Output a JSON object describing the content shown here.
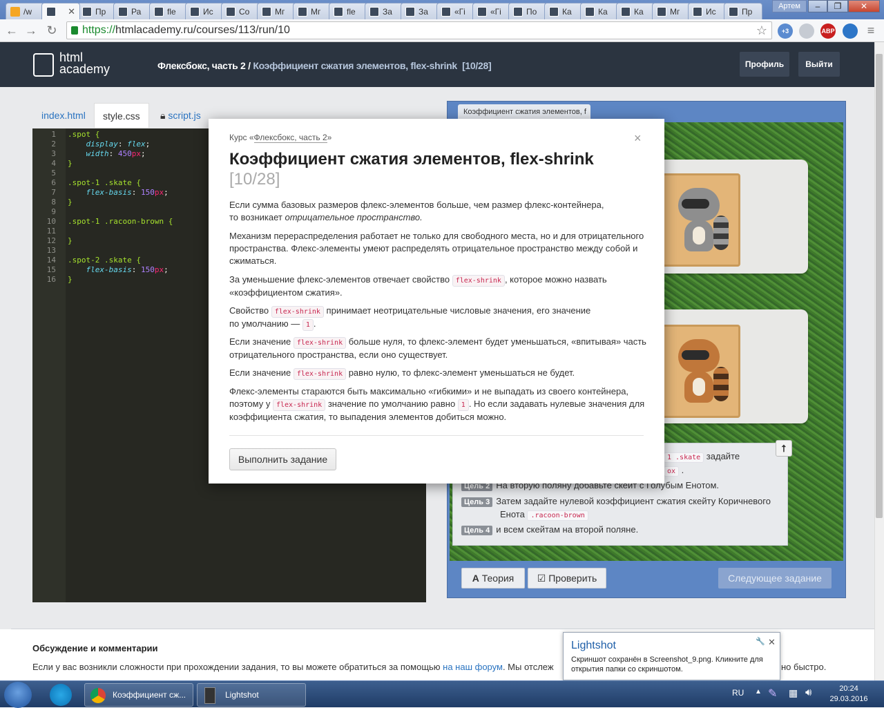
{
  "browser": {
    "tabs": [
      {
        "label": "/w",
        "favicon": "bolt"
      },
      {
        "label": "",
        "favicon": "htmlacademy",
        "active": true
      },
      {
        "label": "Пр",
        "favicon": "htmlacademy"
      },
      {
        "label": "Ра",
        "favicon": "htmlacademy"
      },
      {
        "label": "fle",
        "favicon": "htmlacademy"
      },
      {
        "label": "Ис",
        "favicon": "htmlacademy"
      },
      {
        "label": "Со",
        "favicon": "htmlacademy"
      },
      {
        "label": "Мг",
        "favicon": "htmlacademy"
      },
      {
        "label": "Мг",
        "favicon": "htmlacademy"
      },
      {
        "label": "fle",
        "favicon": "htmlacademy"
      },
      {
        "label": "За",
        "favicon": "htmlacademy"
      },
      {
        "label": "За",
        "favicon": "htmlacademy"
      },
      {
        "label": "«Гі",
        "favicon": "htmlacademy"
      },
      {
        "label": "«Гі",
        "favicon": "htmlacademy"
      },
      {
        "label": "По",
        "favicon": "htmlacademy"
      },
      {
        "label": "Ка",
        "favicon": "htmlacademy"
      },
      {
        "label": "Ка",
        "favicon": "htmlacademy"
      },
      {
        "label": "Ка",
        "favicon": "htmlacademy"
      },
      {
        "label": "Мг",
        "favicon": "htmlacademy"
      },
      {
        "label": "Ис",
        "favicon": "htmlacademy"
      },
      {
        "label": "Пр",
        "favicon": "htmlacademy"
      }
    ],
    "user_label": "Артем",
    "url_scheme": "https://",
    "url_rest": "htmlacademy.ru/courses/113/run/10",
    "ext_badge": "+3",
    "abp_label": "ABP"
  },
  "header": {
    "logo_line1": "html",
    "logo_line2": "academy",
    "crumb_course": "Флексбокс, часть 2 /",
    "crumb_lesson": "Коэффициент сжатия элементов, flex-shrink",
    "crumb_counter": "[10/28]",
    "profile_label": "Профиль",
    "logout_label": "Выйти"
  },
  "editor": {
    "tabs": [
      {
        "label": "index.html",
        "active": false
      },
      {
        "label": "style.css",
        "active": true
      },
      {
        "label": "script.js",
        "active": false,
        "locked": true
      }
    ],
    "lines": [
      {
        "n": "1",
        "sel": ".spot {"
      },
      {
        "n": "2",
        "prop": "display",
        "val": "flex",
        "num": "",
        "unit": ""
      },
      {
        "n": "3",
        "prop": "width",
        "val": "",
        "num": "450",
        "unit": "px"
      },
      {
        "n": "4",
        "sel": "}"
      },
      {
        "n": "5",
        "sel": ""
      },
      {
        "n": "6",
        "sel": ".spot-1 .skate {"
      },
      {
        "n": "7",
        "prop": "flex-basis",
        "val": "",
        "num": "150",
        "unit": "px"
      },
      {
        "n": "8",
        "sel": "}"
      },
      {
        "n": "9",
        "sel": ""
      },
      {
        "n": "10",
        "sel": ".spot-1 .racoon-brown {"
      },
      {
        "n": "11",
        "sel": ""
      },
      {
        "n": "12",
        "sel": "}"
      },
      {
        "n": "13",
        "sel": ""
      },
      {
        "n": "14",
        "sel": ".spot-2 .skate {"
      },
      {
        "n": "15",
        "prop": "flex-basis",
        "val": "",
        "num": "150",
        "unit": "px"
      },
      {
        "n": "16",
        "sel": "}"
      }
    ]
  },
  "preview": {
    "tab_label": "Коэффициент сжатия элементов, f",
    "tasks": {
      "goal1_tail": "1 .skate",
      "goal1_word": "задайте",
      "goal1_pill2": "ох",
      "goal2_label": "Цель 2",
      "goal2_text": "На вторую поляну добавьте скейт с Голубым Енотом.",
      "goal3_label": "Цель 3",
      "goal3_text": "Затем задайте нулевой коэффициент сжатия скейту Коричневого",
      "goal3_text2": "Енота",
      "goal3_pill": ".racoon-brown",
      "goal4_label": "Цель 4",
      "goal4_text": "и всем скейтам на второй поляне."
    },
    "up_label": "🠕",
    "theory_label": "Теория",
    "check_label": "Проверить",
    "next_label": "Следующее задание"
  },
  "discussion": {
    "title": "Обсуждение и комментарии",
    "text_before": "Если у вас возникли сложности при прохождении задания, то вы можете обратиться за помощью ",
    "link": "на наш форум",
    "text_after": ". Мы отслеж",
    "text_end": "но быстро."
  },
  "modal": {
    "course_prefix": "Курс «",
    "course_link": "Флексбокс, часть 2",
    "course_suffix": "»",
    "close": "×",
    "title": "Коэффициент сжатия элементов, flex-shrink",
    "counter": "[10/28]",
    "p1a": "Если сумма базовых размеров флекс-элементов больше, чем размер флекс-контейнера,",
    "p1b": "то возникает ",
    "p1em": "отрицательное пространство.",
    "p2": "Механизм перераспределения работает не только для свободного места, но и для отрицательного пространства. Флекс-элементы умеют распределять отрицательное пространство между собой и сжиматься.",
    "p3a": "За уменьшение флекс-элементов отвечает свойство ",
    "p3code": "flex-shrink",
    "p3b": ", которое можно назвать «коэффициентом сжатия».",
    "p4a": "Свойство ",
    "p4code": "flex-shrink",
    "p4b": " принимает неотрицательные числовые значения, его значение",
    "p4c": "по умолчанию — ",
    "p4code2": "1",
    "p4d": ".",
    "p5a": "Если значение ",
    "p5code": "flex-shrink",
    "p5b": " больше нуля, то флекс-элемент будет уменьшаться, «впитывая» часть отрицательного пространства, если оно существует.",
    "p6a": "Если значение ",
    "p6code": "flex-shrink",
    "p6b": " равно нулю, то флекс-элемент уменьшаться не будет.",
    "p7a": "Флекс-элементы стараются быть максимально «гибкими» и не выпадать из своего контейнера, поэтому у ",
    "p7code": "flex-shrink",
    "p7b": " значение по умолчанию равно ",
    "p7code2": "1",
    "p7c": ". Но если задавать нулевые значения для коэффициента сжатия, то выпадения элементов добиться можно.",
    "button": "Выполнить задание"
  },
  "lightshot": {
    "title": "Lightshot",
    "text": "Скриншот сохранён в Screenshot_9.png. Кликните для открытия папки со скриншотом.",
    "close": "✕",
    "pin": "🔧"
  },
  "taskbar": {
    "chrome_label": "Коэффициент сж...",
    "lightshot_label": "Lightshot",
    "lang": "RU",
    "time": "20:24",
    "date": "29.03.2016"
  },
  "colors": {
    "header_bg": "#2b3440",
    "preview_bg": "#5d86c4",
    "editor_bg": "#272822",
    "link": "#2a73c0"
  }
}
